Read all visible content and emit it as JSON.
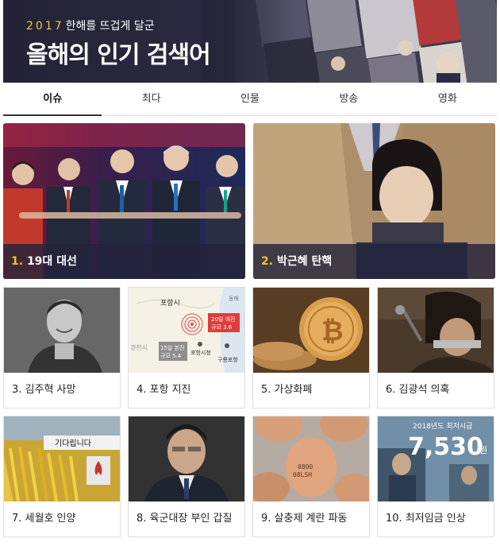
{
  "header": {
    "year": "2017",
    "subtitle": "한해를 뜨겁게 달군",
    "title": "올해의 인기 검색어"
  },
  "tabs": [
    {
      "label": "이슈",
      "active": true
    },
    {
      "label": "최다"
    },
    {
      "label": "인물"
    },
    {
      "label": "방송"
    },
    {
      "label": "영화"
    }
  ],
  "featured": [
    {
      "rank": "1.",
      "label": "19대 대선"
    },
    {
      "rank": "2.",
      "label": "박근혜 탄핵"
    }
  ],
  "items": [
    {
      "label": "3. 김주혁 사망"
    },
    {
      "label": "4. 포항 지진"
    },
    {
      "label": "5. 가상화폐"
    },
    {
      "label": "6. 김광석 의혹"
    },
    {
      "label": "7. 세월호 인양"
    },
    {
      "label": "8. 육군대장 부인 갑질"
    },
    {
      "label": "9. 살충제 계란 파동"
    },
    {
      "label": "10. 최저임금 인상"
    }
  ],
  "map_card": {
    "city": "포항시",
    "region_east": "동해",
    "region_west": "경천시",
    "aftershock": "20일 여진",
    "aftershock_mag": "규모 3.6",
    "mainshock": "15일 본진",
    "mainshock_mag": "규모 5.4",
    "city_hall": "포항시청",
    "port": "구룡포항"
  },
  "wage_card": {
    "caption": "2018년도 최저시급",
    "amount": "7,530",
    "unit": "원"
  },
  "sewol_card": {
    "banner_text": "기다립니다"
  },
  "colors": {
    "accent_yellow": "#f3c21b",
    "banner_bg": "#252438",
    "caption_bg": "#23233c",
    "aftershock_red": "#e23b3b"
  }
}
